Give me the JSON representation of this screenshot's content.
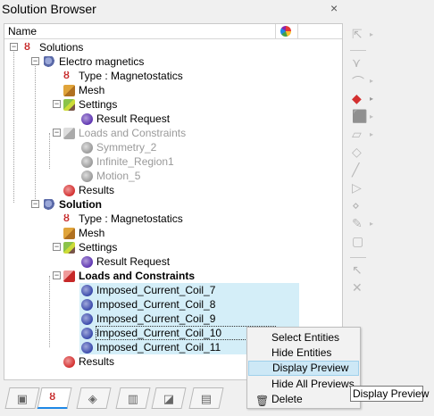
{
  "window": {
    "title": "Solution Browser",
    "close_glyph": "×"
  },
  "header": {
    "name_col": "Name",
    "color_col_icon": "color-wheel-icon"
  },
  "tree": {
    "solutions": "Solutions",
    "electro": {
      "label": "Electro magnetics",
      "type": "Type : Magnetostatics",
      "mesh": "Mesh",
      "settings": "Settings",
      "result_request": "Result Request",
      "loads": "Loads and Constraints",
      "loads_items": [
        "Symmetry_2",
        "Infinite_Region1",
        "Motion_5"
      ],
      "results": "Results"
    },
    "solution": {
      "label": "Solution",
      "type": "Type : Magnetostatics",
      "mesh": "Mesh",
      "settings": "Settings",
      "result_request": "Result Request",
      "loads": "Loads and Constraints",
      "loads_items": [
        "Imposed_Current_Coil_7",
        "Imposed_Current_Coil_8",
        "Imposed_Current_Coil_9",
        "Imposed_Current_Coil_10",
        "Imposed_Current_Coil_11"
      ],
      "results": "Results"
    }
  },
  "context_menu": {
    "items": [
      "Select Entities",
      "Hide Entities",
      "Display Preview",
      "Hide All Previews",
      "Delete"
    ],
    "highlighted": "Display Preview"
  },
  "tooltip": "Display Preview",
  "colors": {
    "selection": "#d4eef8",
    "menu_highlight": "#cde8f6",
    "accent": "#c62828"
  }
}
